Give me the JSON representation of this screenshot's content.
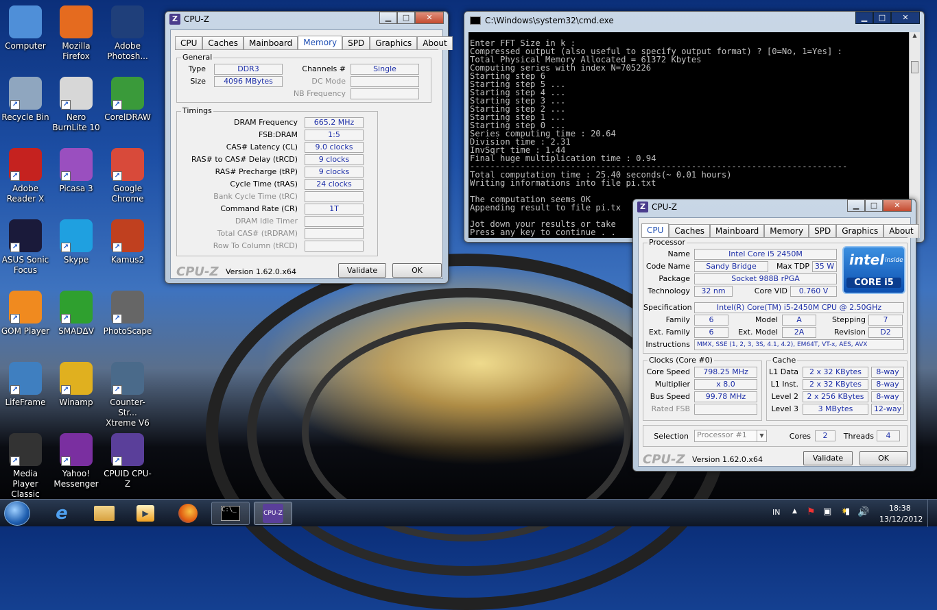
{
  "desktop": {
    "icons": [
      {
        "label": "Computer",
        "icon": "computer-icon",
        "color": "#4f8fd8"
      },
      {
        "label": "Mozilla Firefox",
        "icon": "firefox-icon",
        "color": "#e56b1f"
      },
      {
        "label": "Adobe Photosh...",
        "icon": "photoshop-icon",
        "color": "#1f3f7a"
      },
      {
        "label": "Recycle Bin",
        "icon": "recycle-bin-icon",
        "color": "#8fa6bf"
      },
      {
        "label": "Nero BurnLite 10",
        "icon": "nero-icon",
        "color": "#d7d7d7"
      },
      {
        "label": "CorelDRAW",
        "icon": "coreldraw-icon",
        "color": "#3a9a3a"
      },
      {
        "label": "Adobe Reader X",
        "icon": "adobe-reader-icon",
        "color": "#c5221f"
      },
      {
        "label": "Picasa 3",
        "icon": "picasa-icon",
        "color": "#9a4fbf"
      },
      {
        "label": "Google Chrome",
        "icon": "chrome-icon",
        "color": "#d84a3a"
      },
      {
        "label": "ASUS Sonic Focus",
        "icon": "asus-sonic-icon",
        "color": "#1a1a3a"
      },
      {
        "label": "Skype",
        "icon": "skype-icon",
        "color": "#1fa0e0"
      },
      {
        "label": "Kamus2",
        "icon": "kamus-icon",
        "color": "#c0401f"
      },
      {
        "label": "GOM Player",
        "icon": "gom-player-icon",
        "color": "#f08a1f"
      },
      {
        "label": "SMADΔV",
        "icon": "smadav-icon",
        "color": "#2fa02f"
      },
      {
        "label": "PhotoScape",
        "icon": "photoscape-icon",
        "color": "#666666"
      },
      {
        "label": "LifeFrame",
        "icon": "lifeframe-icon",
        "color": "#3f7fc0"
      },
      {
        "label": "Winamp",
        "icon": "winamp-icon",
        "color": "#e0b01f"
      },
      {
        "label": "Counter-Str... Xtreme V6",
        "icon": "counter-strike-icon",
        "color": "#4a6a8a"
      },
      {
        "label": "Media Player Classic",
        "icon": "media-player-classic-icon",
        "color": "#333333"
      },
      {
        "label": "Yahoo! Messenger",
        "icon": "yahoo-messenger-icon",
        "color": "#7a2fa0"
      },
      {
        "label": "CPUID CPU-Z",
        "icon": "cpuz-icon",
        "color": "#5a3f9a"
      }
    ]
  },
  "cpuz_mem": {
    "title": "CPU-Z",
    "tabs": [
      "CPU",
      "Caches",
      "Mainboard",
      "Memory",
      "SPD",
      "Graphics",
      "About"
    ],
    "active_tab": "Memory",
    "general_label": "General",
    "type_label": "Type",
    "type": "DDR3",
    "size_label": "Size",
    "size": "4096 MBytes",
    "channels_label": "Channels #",
    "channels": "Single",
    "dc_mode_label": "DC Mode",
    "dc_mode": "",
    "nb_freq_label": "NB Frequency",
    "nb_freq": "",
    "timings_label": "Timings",
    "timings": [
      {
        "label": "DRAM Frequency",
        "value": "665.2 MHz",
        "enabled": true
      },
      {
        "label": "FSB:DRAM",
        "value": "1:5",
        "enabled": true
      },
      {
        "label": "CAS# Latency (CL)",
        "value": "9.0 clocks",
        "enabled": true
      },
      {
        "label": "RAS# to CAS# Delay (tRCD)",
        "value": "9 clocks",
        "enabled": true
      },
      {
        "label": "RAS# Precharge (tRP)",
        "value": "9 clocks",
        "enabled": true
      },
      {
        "label": "Cycle Time (tRAS)",
        "value": "24 clocks",
        "enabled": true
      },
      {
        "label": "Bank Cycle Time (tRC)",
        "value": "",
        "enabled": false
      },
      {
        "label": "Command Rate (CR)",
        "value": "1T",
        "enabled": true
      },
      {
        "label": "DRAM Idle Timer",
        "value": "",
        "enabled": false
      },
      {
        "label": "Total CAS# (tRDRAM)",
        "value": "",
        "enabled": false
      },
      {
        "label": "Row To Column (tRCD)",
        "value": "",
        "enabled": false
      }
    ],
    "logo": "CPU-Z",
    "version": "Version 1.62.0.x64",
    "validate": "Validate",
    "ok": "OK"
  },
  "cmd": {
    "title": "C:\\Windows\\system32\\cmd.exe",
    "text": "Enter FFT Size in k :\nCompressed output (also useful to specify output format) ? [0=No, 1=Yes] :\nTotal Physical Memory Allocated = 61372 Kbytes\nComputing series with index N=705226\nStarting step 6\nStarting step 5 ...\nStarting step 4 ...\nStarting step 3 ...\nStarting step 2 ...\nStarting step 1 ...\nStarting step 0 ...\nSeries computing time : 20.64\nDivision time : 2.31\nInvSqrt time : 1.44\nFinal huge multiplication time : 0.94\n---------------------------------------------------------------------------\nTotal computation time : 25.40 seconds(~ 0.01 hours)\nWriting informations into file pi.txt\n\nThe computation seems OK\nAppending result to file pi.tx\n\nJot down your results or take\nPress any key to continue . ."
  },
  "cpuz_cpu": {
    "title": "CPU-Z",
    "tabs": [
      "CPU",
      "Caches",
      "Mainboard",
      "Memory",
      "SPD",
      "Graphics",
      "About"
    ],
    "active_tab": "CPU",
    "processor_label": "Processor",
    "name_label": "Name",
    "name": "Intel Core i5 2450M",
    "codename_label": "Code Name",
    "codename": "Sandy Bridge",
    "maxtdp_label": "Max TDP",
    "maxtdp": "35 W",
    "package_label": "Package",
    "package": "Socket 988B rPGA",
    "tech_label": "Technology",
    "tech": "32 nm",
    "corevid_label": "Core VID",
    "corevid": "0.760 V",
    "spec_label": "Specification",
    "spec": "Intel(R) Core(TM) i5-2450M CPU @ 2.50GHz",
    "family_label": "Family",
    "family": "6",
    "model_label": "Model",
    "model": "A",
    "stepping_label": "Stepping",
    "stepping": "7",
    "extfamily_label": "Ext. Family",
    "extfamily": "6",
    "extmodel_label": "Ext. Model",
    "extmodel": "2A",
    "revision_label": "Revision",
    "revision": "D2",
    "instr_label": "Instructions",
    "instr": "MMX, SSE (1, 2, 3, 3S, 4.1, 4.2), EM64T, VT-x, AES, AVX",
    "clocks_label": "Clocks (Core #0)",
    "corespeed_label": "Core Speed",
    "corespeed": "798.25 MHz",
    "mult_label": "Multiplier",
    "mult": "x 8.0",
    "bus_label": "Bus Speed",
    "bus": "99.78 MHz",
    "fsb_label": "Rated FSB",
    "fsb": "",
    "cache_label": "Cache",
    "l1d_label": "L1 Data",
    "l1d": "2 x 32 KBytes",
    "l1d_way": "8-way",
    "l1i_label": "L1 Inst.",
    "l1i": "2 x 32 KBytes",
    "l1i_way": "8-way",
    "l2_label": "Level 2",
    "l2": "2 x 256 KBytes",
    "l2_way": "8-way",
    "l3_label": "Level 3",
    "l3": "3 MBytes",
    "l3_way": "12-way",
    "selection_label": "Selection",
    "selection": "Processor #1",
    "cores_label": "Cores",
    "cores": "2",
    "threads_label": "Threads",
    "threads": "4",
    "intel_brand": "intel",
    "intel_inside": "inside",
    "intel_core": "CORE i5",
    "logo": "CPU-Z",
    "version": "Version 1.62.0.x64",
    "validate": "Validate",
    "ok": "OK"
  },
  "taskbar": {
    "start_icon": "windows-start-icon",
    "items": [
      "internet-explorer-icon",
      "explorer-folder-icon",
      "media-player-icon",
      "firefox-icon",
      "cmd-icon",
      "cpuz-icon"
    ],
    "lang": "IN",
    "time": "18:38",
    "date": "13/12/2012"
  }
}
